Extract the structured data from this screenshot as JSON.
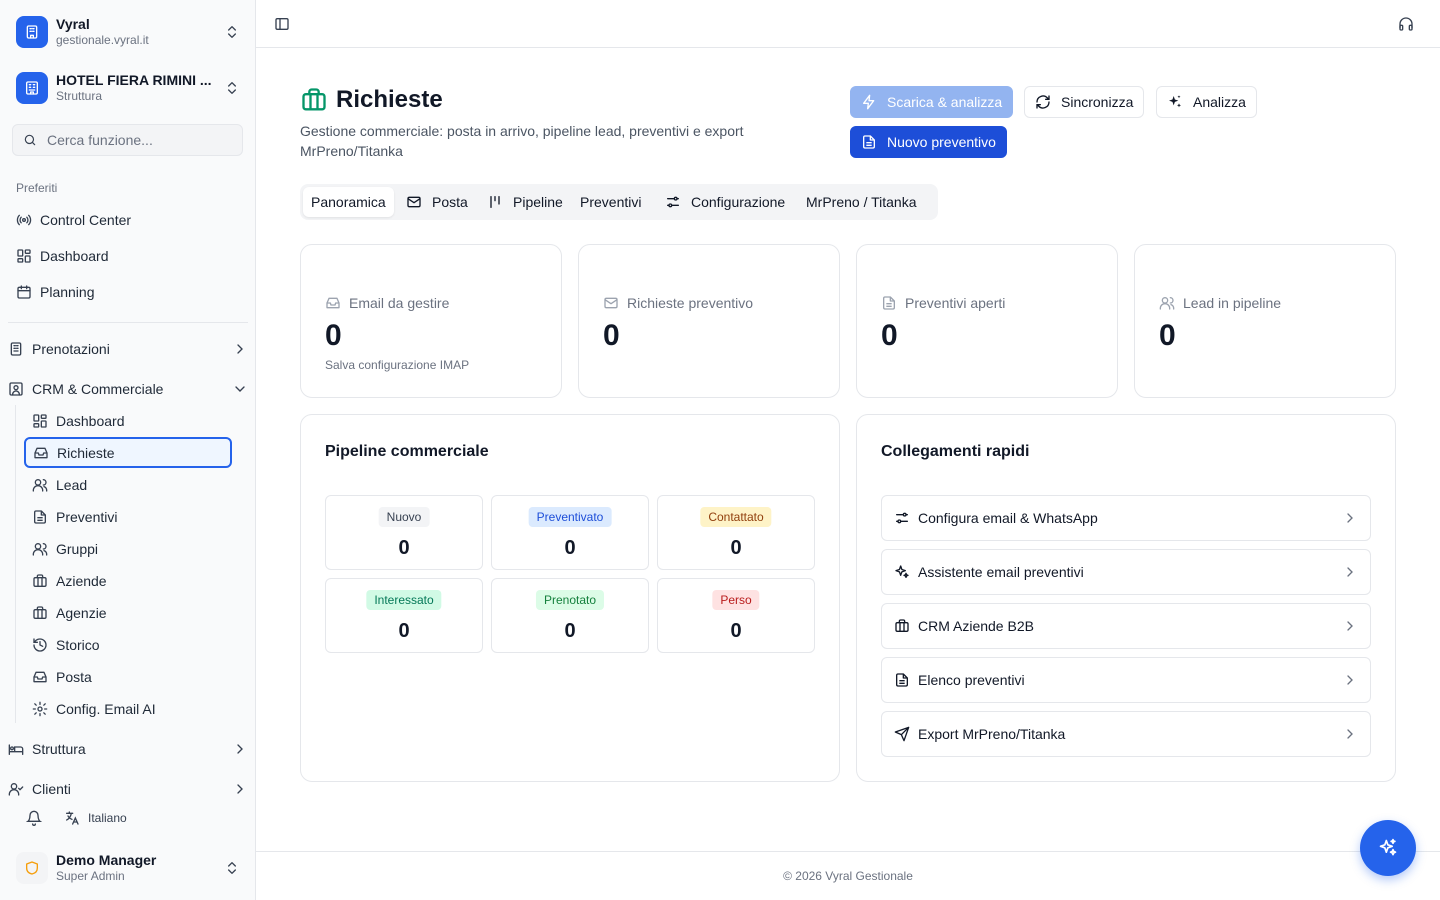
{
  "workspace": {
    "name": "Vyral",
    "domain": "gestionale.vyral.it",
    "icon": "building-icon"
  },
  "property": {
    "name": "HOTEL FIERA RIMINI ...",
    "type": "Struttura",
    "icon": "hotel-icon"
  },
  "search": {
    "placeholder": "Cerca funzione..."
  },
  "favorites": {
    "label": "Preferiti",
    "items": [
      {
        "label": "Control Center",
        "icon": "radio-icon"
      },
      {
        "label": "Dashboard",
        "icon": "grid-icon"
      },
      {
        "label": "Planning",
        "icon": "calendar-icon"
      }
    ]
  },
  "nav": {
    "prenotazioni": "Prenotazioni",
    "crm": "CRM & Commerciale",
    "crm_items": [
      {
        "label": "Dashboard",
        "icon": "grid-icon"
      },
      {
        "label": "Richieste",
        "icon": "inbox-icon",
        "active": true
      },
      {
        "label": "Lead",
        "icon": "users-icon"
      },
      {
        "label": "Preventivi",
        "icon": "file-text-icon"
      },
      {
        "label": "Gruppi",
        "icon": "users-icon"
      },
      {
        "label": "Aziende",
        "icon": "briefcase-icon"
      },
      {
        "label": "Agenzie",
        "icon": "briefcase-icon"
      },
      {
        "label": "Storico",
        "icon": "history-icon"
      },
      {
        "label": "Posta",
        "icon": "inbox-icon"
      },
      {
        "label": "Config. Email AI",
        "icon": "gear-icon"
      }
    ],
    "struttura": "Struttura",
    "clienti": "Clienti"
  },
  "language": "Italiano",
  "user": {
    "name": "Demo Manager",
    "role": "Super Admin"
  },
  "page": {
    "title": "Richieste",
    "subtitle": "Gestione commerciale: posta in arrivo, pipeline lead, preventivi e export MrPreno/Titanka"
  },
  "actions": {
    "download": "Scarica & analizza",
    "sync": "Sincronizza",
    "analyze": "Analizza",
    "new_quote": "Nuovo preventivo"
  },
  "tabs": [
    {
      "label": "Panoramica",
      "active": true
    },
    {
      "label": "Posta",
      "icon": "mail-icon"
    },
    {
      "label": "Pipeline",
      "icon": "kanban-icon"
    },
    {
      "label": "Preventivi"
    },
    {
      "label": "Configurazione",
      "icon": "sliders-icon"
    },
    {
      "label": "MrPreno / Titanka"
    }
  ],
  "stats": [
    {
      "label": "Email da gestire",
      "value": "0",
      "hint": "Salva configurazione IMAP",
      "icon": "inbox-icon"
    },
    {
      "label": "Richieste preventivo",
      "value": "0",
      "icon": "mail-icon"
    },
    {
      "label": "Preventivi aperti",
      "value": "0",
      "icon": "file-text-icon"
    },
    {
      "label": "Lead in pipeline",
      "value": "0",
      "icon": "users-icon"
    }
  ],
  "pipeline": {
    "title": "Pipeline commerciale",
    "stages": [
      {
        "label": "Nuovo",
        "value": "0",
        "bg": "#f3f4f6",
        "fg": "#374151"
      },
      {
        "label": "Preventivato",
        "value": "0",
        "bg": "#dbeafe",
        "fg": "#1d4ed8"
      },
      {
        "label": "Contattato",
        "value": "0",
        "bg": "#fef3c7",
        "fg": "#92400e"
      },
      {
        "label": "Interessato",
        "value": "0",
        "bg": "#d1fae5",
        "fg": "#047857"
      },
      {
        "label": "Prenotato",
        "value": "0",
        "bg": "#dcfce7",
        "fg": "#15803d"
      },
      {
        "label": "Perso",
        "value": "0",
        "bg": "#fee2e2",
        "fg": "#b91c1c"
      }
    ]
  },
  "quick_links": {
    "title": "Collegamenti rapidi",
    "items": [
      {
        "label": "Configura email & WhatsApp",
        "icon": "sliders-icon"
      },
      {
        "label": "Assistente email preventivi",
        "icon": "sparkles-icon"
      },
      {
        "label": "CRM Aziende B2B",
        "icon": "briefcase-icon"
      },
      {
        "label": "Elenco preventivi",
        "icon": "file-text-icon"
      },
      {
        "label": "Export MrPreno/Titanka",
        "icon": "send-icon"
      }
    ]
  },
  "footer": "© 2026 Vyral Gestionale",
  "colors": {
    "accent": "#2563eb",
    "brand_green": "#059669"
  }
}
